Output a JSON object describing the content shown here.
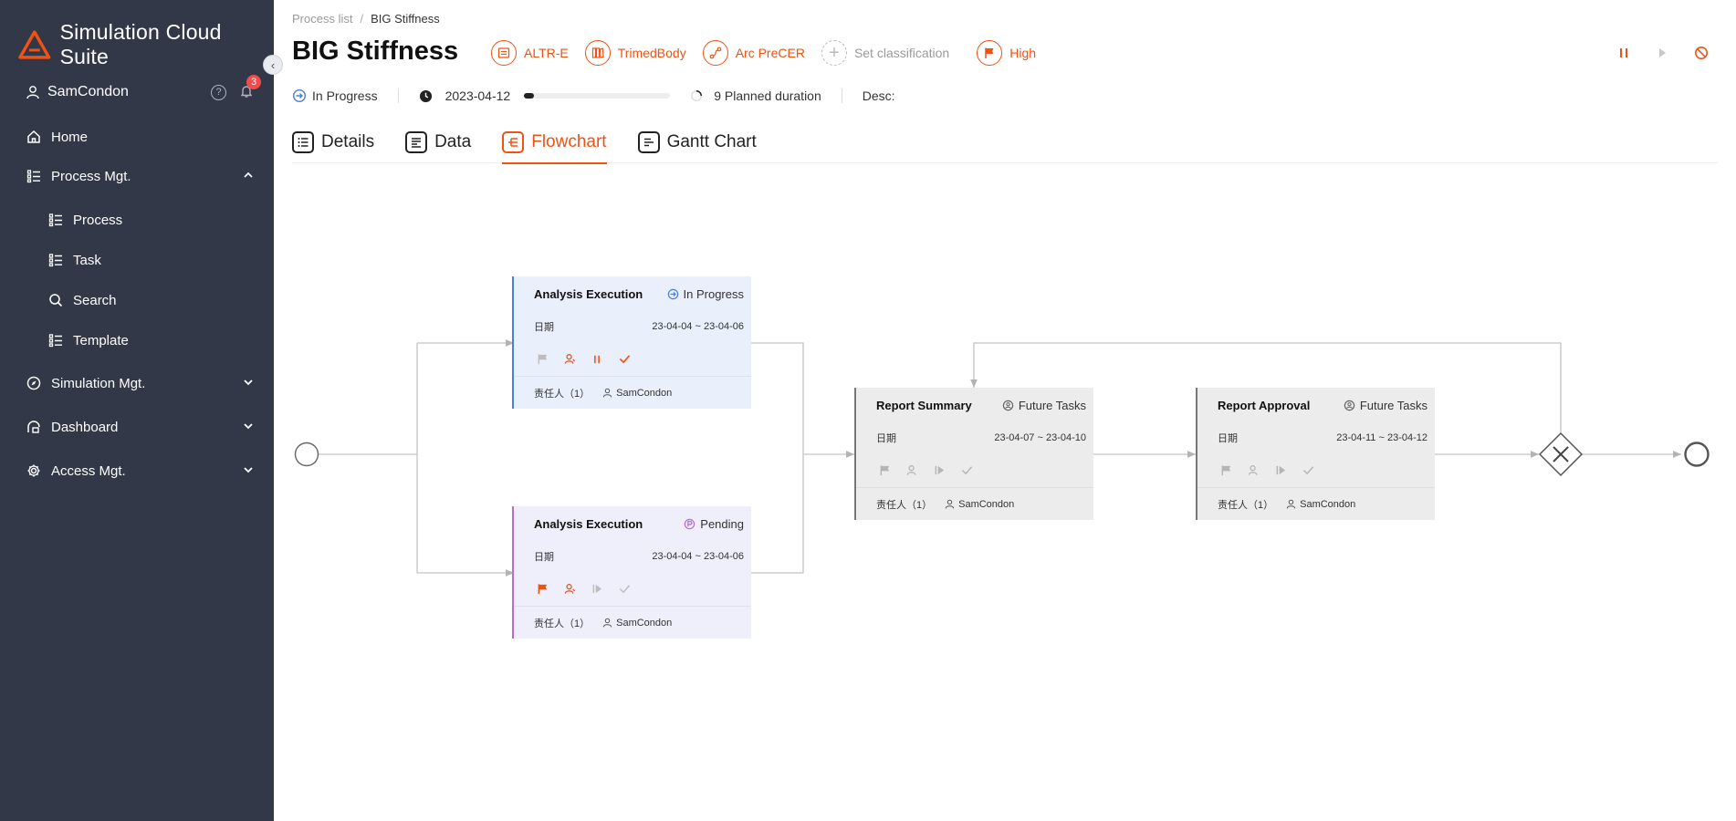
{
  "app": {
    "name": "Simulation Cloud Suite"
  },
  "sidebar": {
    "user": "SamCondon",
    "notifications": "3",
    "items": [
      {
        "label": "Home",
        "icon": "home-icon"
      },
      {
        "label": "Process Mgt.",
        "icon": "list-icon",
        "expanded": true
      },
      {
        "label": "Process",
        "icon": "list-icon"
      },
      {
        "label": "Task",
        "icon": "list-icon"
      },
      {
        "label": "Search",
        "icon": "search-icon"
      },
      {
        "label": "Template",
        "icon": "list-icon"
      },
      {
        "label": "Simulation Mgt.",
        "icon": "compass-icon"
      },
      {
        "label": "Dashboard",
        "icon": "dashboard-icon"
      },
      {
        "label": "Access Mgt.",
        "icon": "gear-icon"
      }
    ]
  },
  "breadcrumb": {
    "parent": "Process list",
    "separator": "/",
    "current": "BIG Stiffness"
  },
  "title": "BIG Stiffness",
  "tags": [
    "ALTR-E",
    "TrimedBody",
    "Arc PreCER",
    "Set classification",
    "High"
  ],
  "status": {
    "state": "In Progress",
    "date": "2023-04-12",
    "progress": 0.07,
    "planned": "9 Planned duration",
    "desc": "Desc:"
  },
  "tabs": [
    "Details",
    "Data",
    "Flowchart",
    "Gantt Chart"
  ],
  "active_tab": "Flowchart",
  "colors": {
    "accent": "#ec5314",
    "sidebar": "#323848",
    "in_progress": "#4a7fd6",
    "pending": "#b66bd4"
  },
  "flow": {
    "nodes": [
      {
        "name": "Analysis Execution",
        "status": "In Progress",
        "date_label": "日期",
        "dates": "23-04-04 ~ 23-04-06",
        "owner_label": "责任人（1）",
        "owner": "SamCondon"
      },
      {
        "name": "Analysis Execution",
        "status": "Pending",
        "date_label": "日期",
        "dates": "23-04-04 ~ 23-04-06",
        "owner_label": "责任人（1）",
        "owner": "SamCondon"
      },
      {
        "name": "Report Summary",
        "status": "Future Tasks",
        "date_label": "日期",
        "dates": "23-04-07 ~ 23-04-10",
        "owner_label": "责任人（1）",
        "owner": "SamCondon"
      },
      {
        "name": "Report Approval",
        "status": "Future Tasks",
        "date_label": "日期",
        "dates": "23-04-11 ~ 23-04-12",
        "owner_label": "责任人（1）",
        "owner": "SamCondon"
      }
    ]
  }
}
